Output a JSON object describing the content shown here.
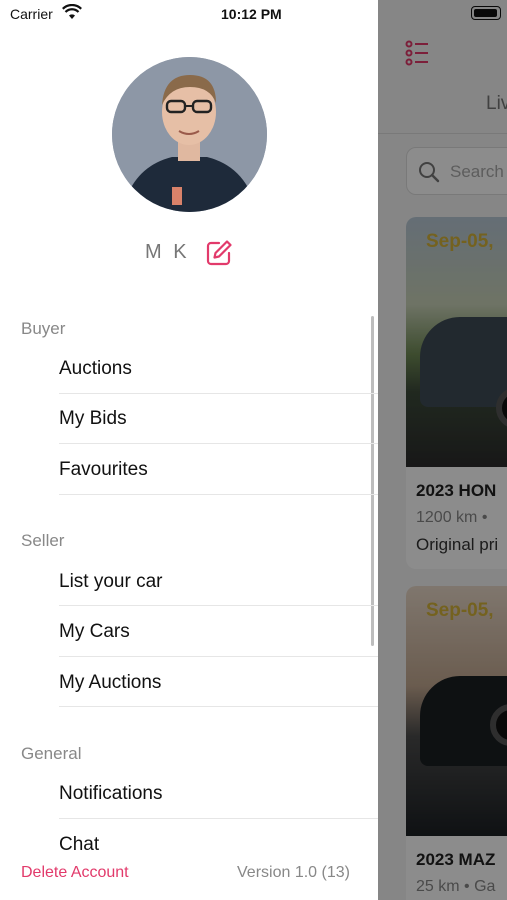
{
  "status_bar": {
    "carrier": "Carrier",
    "time": "10:12 PM"
  },
  "profile": {
    "name": "M K"
  },
  "sections": [
    {
      "title": "Buyer",
      "items": [
        "Auctions",
        "My Bids",
        "Favourites"
      ]
    },
    {
      "title": "Seller",
      "items": [
        "List your car",
        "My Cars",
        "My Auctions"
      ]
    },
    {
      "title": "General",
      "items": [
        "Notifications",
        "Chat"
      ]
    }
  ],
  "footer": {
    "delete_label": "Delete Account",
    "version": "Version 1.0 (13)"
  },
  "background": {
    "tab_label": "Liv",
    "search_placeholder": "Search",
    "cards": [
      {
        "date": "Sep-05,",
        "title": "2023 HON",
        "sub": "1200 km •",
        "price": "Original pri"
      },
      {
        "date": "Sep-05,",
        "title": "2023 MAZ",
        "sub": "25 km • Ga"
      }
    ]
  },
  "colors": {
    "accent": "#e23a6b",
    "section_title": "#888888",
    "drawer_bg": "#ffffff"
  }
}
